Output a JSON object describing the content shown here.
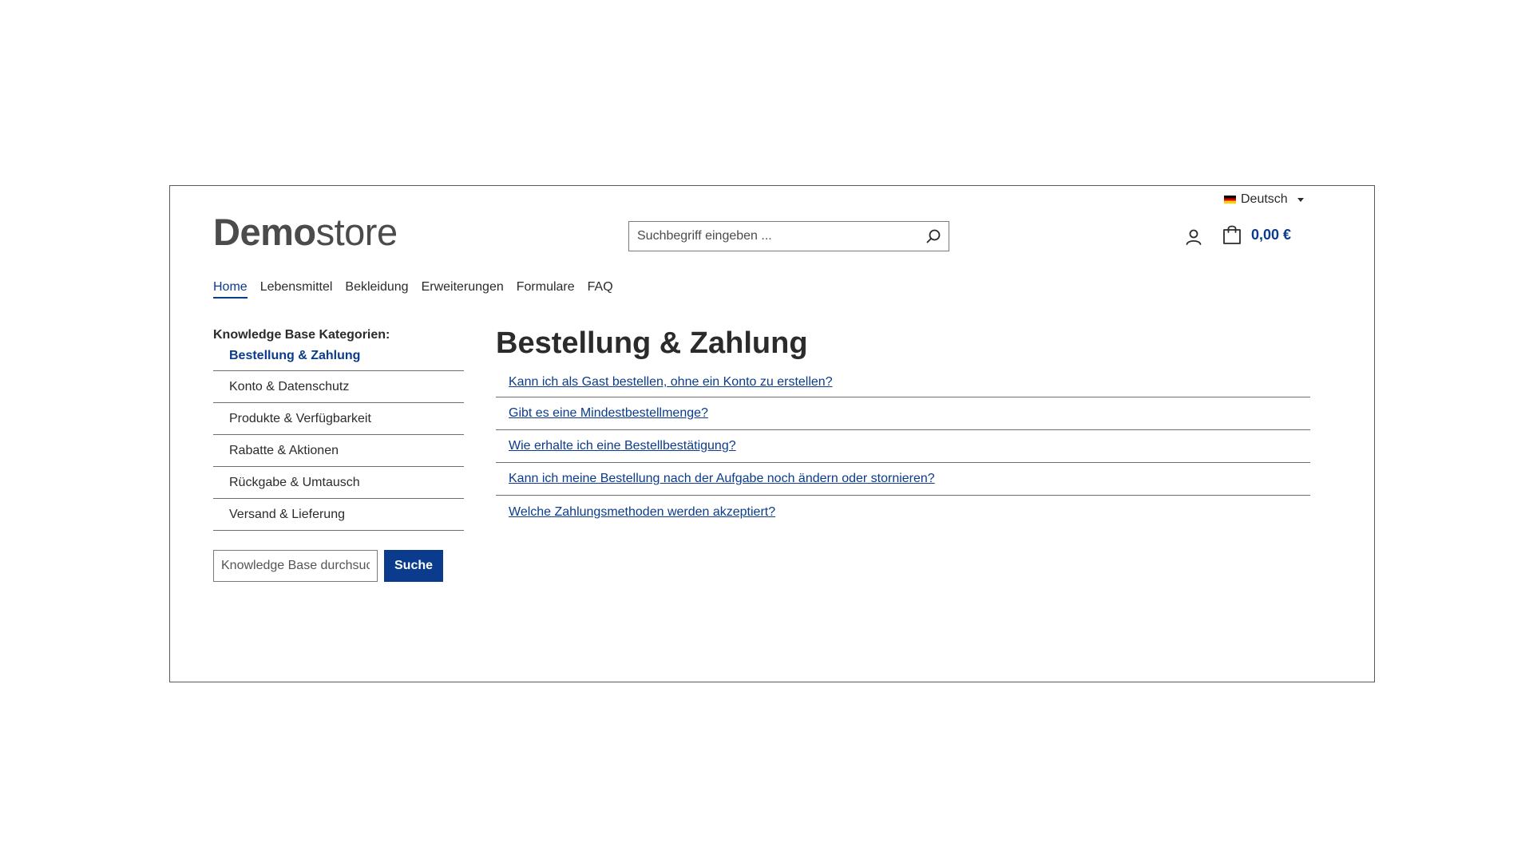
{
  "header": {
    "language": "Deutsch",
    "logo_bold": "Demo",
    "logo_light": "store",
    "search_placeholder": "Suchbegriff eingeben ...",
    "cart_total": "0,00 €"
  },
  "nav": {
    "items": [
      "Home",
      "Lebensmittel",
      "Bekleidung",
      "Erweiterungen",
      "Formulare",
      "FAQ"
    ],
    "active": "Home"
  },
  "sidebar": {
    "heading": "Knowledge Base Kategorien:",
    "items": [
      "Bestellung & Zahlung",
      "Konto & Datenschutz",
      "Produkte & Verfügbarkeit",
      "Rabatte & Aktionen",
      "Rückgabe & Umtausch",
      "Versand & Lieferung"
    ],
    "active": "Bestellung & Zahlung",
    "search_placeholder": "Knowledge Base durchsuchen",
    "search_button": "Suche"
  },
  "main": {
    "title": "Bestellung & Zahlung",
    "questions": [
      "Kann ich als Gast bestellen, ohne ein Konto zu erstellen?",
      "Gibt es eine Mindestbestellmenge?",
      "Wie erhalte ich eine Bestellbestätigung?",
      "Kann ich meine Bestellung nach der Aufgabe noch ändern oder stornieren?",
      "Welche Zahlungsmethoden werden akzeptiert?"
    ]
  },
  "colors": {
    "accent": "#0b3b8c",
    "text": "#2b2b2b"
  },
  "icons": [
    "germany-flag-icon",
    "chevron-down-icon",
    "search-icon",
    "user-icon",
    "shopping-bag-icon"
  ]
}
